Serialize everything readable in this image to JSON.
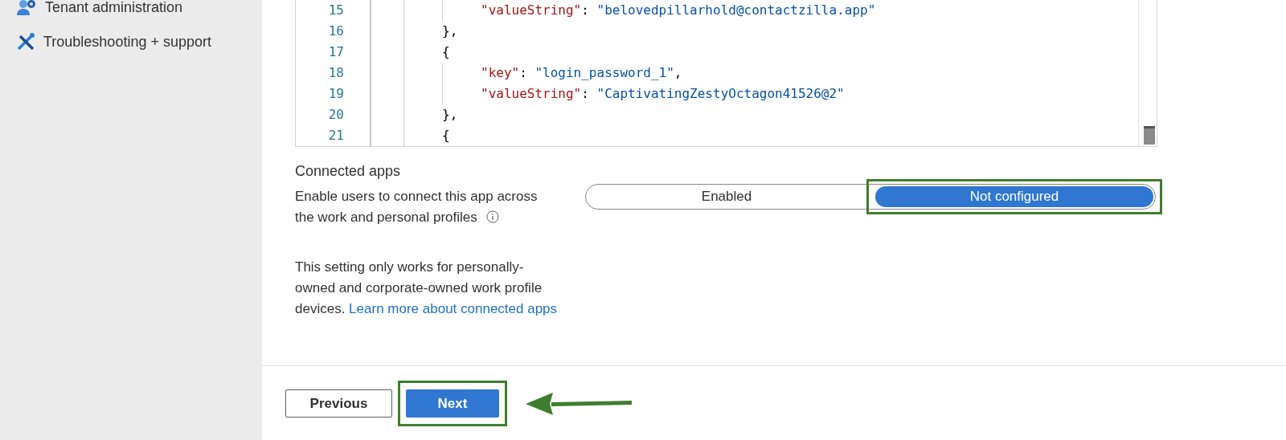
{
  "sidebar": {
    "items": [
      {
        "label": "Tenant administration"
      },
      {
        "label": "Troubleshooting + support"
      }
    ]
  },
  "editor": {
    "lines": [
      {
        "number": "15",
        "tokens": [
          {
            "kind": "key",
            "text": "\"valueString\""
          },
          {
            "kind": "punct",
            "text": ": "
          },
          {
            "kind": "string",
            "text": "\"belovedpillarhold@contactzilla.app\""
          }
        ]
      },
      {
        "number": "16",
        "tokens": [
          {
            "kind": "punct",
            "text": "},"
          }
        ]
      },
      {
        "number": "17",
        "tokens": [
          {
            "kind": "punct",
            "text": "{"
          }
        ]
      },
      {
        "number": "18",
        "tokens": [
          {
            "kind": "key",
            "text": "\"key\""
          },
          {
            "kind": "punct",
            "text": ": "
          },
          {
            "kind": "string",
            "text": "\"login_password_1\""
          },
          {
            "kind": "punct",
            "text": ","
          }
        ]
      },
      {
        "number": "19",
        "tokens": [
          {
            "kind": "key",
            "text": "\"valueString\""
          },
          {
            "kind": "punct",
            "text": ": "
          },
          {
            "kind": "string",
            "text": "\"CaptivatingZestyOctagon41526@2\""
          }
        ]
      },
      {
        "number": "20",
        "tokens": [
          {
            "kind": "punct",
            "text": "},"
          }
        ]
      },
      {
        "number": "21",
        "tokens": [
          {
            "kind": "punct",
            "text": "{"
          }
        ]
      }
    ]
  },
  "connected_apps": {
    "heading": "Connected apps",
    "label": "Enable users to connect this app across the work and personal profiles",
    "options": [
      {
        "label": "Enabled",
        "selected": false,
        "highlighted": false
      },
      {
        "label": "Not configured",
        "selected": true,
        "highlighted": true
      }
    ],
    "note": "This setting only works for personally-owned and corporate-owned work profile devices.",
    "link": "Learn more about connected apps"
  },
  "footer": {
    "buttons": [
      {
        "label": "Previous",
        "kind": "secondary",
        "highlighted": false,
        "pointed": false
      },
      {
        "label": "Next",
        "kind": "primary",
        "highlighted": true,
        "pointed": true
      }
    ]
  }
}
